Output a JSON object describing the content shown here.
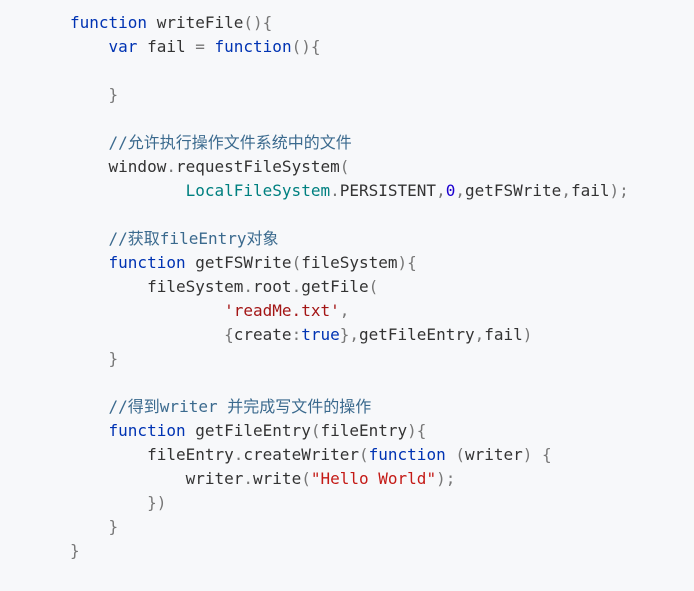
{
  "code": {
    "lines": [
      [
        {
          "t": "function",
          "c": "kw"
        },
        {
          "t": " writeFile",
          "c": ""
        },
        {
          "t": "(){",
          "c": "pu"
        }
      ],
      [
        {
          "t": "    var",
          "c": "kw"
        },
        {
          "t": " fail ",
          "c": ""
        },
        {
          "t": "=",
          "c": "pu"
        },
        {
          "t": " function",
          "c": "kw"
        },
        {
          "t": "(){",
          "c": "pu"
        }
      ],
      [],
      [
        {
          "t": "    }",
          "c": "pu"
        }
      ],
      [],
      [
        {
          "t": "    //允许执行操作文件系统中的文件",
          "c": "cm"
        }
      ],
      [
        {
          "t": "    window",
          "c": ""
        },
        {
          "t": ".",
          "c": "pu"
        },
        {
          "t": "requestFileSystem",
          "c": ""
        },
        {
          "t": "(",
          "c": "pu"
        }
      ],
      [
        {
          "t": "            LocalFileSystem",
          "c": "cl"
        },
        {
          "t": ".",
          "c": "pu"
        },
        {
          "t": "PERSISTENT",
          "c": ""
        },
        {
          "t": ",",
          "c": "pu"
        },
        {
          "t": "0",
          "c": "nu"
        },
        {
          "t": ",",
          "c": "pu"
        },
        {
          "t": "getFSWrite",
          "c": ""
        },
        {
          "t": ",",
          "c": "pu"
        },
        {
          "t": "fail",
          "c": ""
        },
        {
          "t": ");",
          "c": "pu"
        }
      ],
      [],
      [
        {
          "t": "    //获取fileEntry对象",
          "c": "cm"
        }
      ],
      [
        {
          "t": "    function",
          "c": "kw"
        },
        {
          "t": " getFSWrite",
          "c": ""
        },
        {
          "t": "(",
          "c": "pu"
        },
        {
          "t": "fileSystem",
          "c": ""
        },
        {
          "t": "){",
          "c": "pu"
        }
      ],
      [
        {
          "t": "        fileSystem",
          "c": ""
        },
        {
          "t": ".",
          "c": "pu"
        },
        {
          "t": "root",
          "c": ""
        },
        {
          "t": ".",
          "c": "pu"
        },
        {
          "t": "getFile",
          "c": ""
        },
        {
          "t": "(",
          "c": "pu"
        }
      ],
      [
        {
          "t": "                'readMe.txt'",
          "c": "st"
        },
        {
          "t": ",",
          "c": "pu"
        }
      ],
      [
        {
          "t": "                {",
          "c": "pu"
        },
        {
          "t": "create",
          "c": ""
        },
        {
          "t": ":",
          "c": "pu"
        },
        {
          "t": "true",
          "c": "kw"
        },
        {
          "t": "},",
          "c": "pu"
        },
        {
          "t": "getFileEntry",
          "c": ""
        },
        {
          "t": ",",
          "c": "pu"
        },
        {
          "t": "fail",
          "c": ""
        },
        {
          "t": ")",
          "c": "pu"
        }
      ],
      [
        {
          "t": "    }",
          "c": "pu"
        }
      ],
      [],
      [
        {
          "t": "    //得到writer 并完成写文件的操作",
          "c": "cm"
        }
      ],
      [
        {
          "t": "    function",
          "c": "kw"
        },
        {
          "t": " getFileEntry",
          "c": ""
        },
        {
          "t": "(",
          "c": "pu"
        },
        {
          "t": "fileEntry",
          "c": ""
        },
        {
          "t": "){",
          "c": "pu"
        }
      ],
      [
        {
          "t": "        fileEntry",
          "c": ""
        },
        {
          "t": ".",
          "c": "pu"
        },
        {
          "t": "createWriter",
          "c": ""
        },
        {
          "t": "(",
          "c": "pu"
        },
        {
          "t": "function",
          "c": "kw"
        },
        {
          "t": " (",
          "c": "pu"
        },
        {
          "t": "writer",
          "c": ""
        },
        {
          "t": ") {",
          "c": "pu"
        }
      ],
      [
        {
          "t": "            writer",
          "c": ""
        },
        {
          "t": ".",
          "c": "pu"
        },
        {
          "t": "write",
          "c": ""
        },
        {
          "t": "(",
          "c": "pu"
        },
        {
          "t": "\"Hello World\"",
          "c": "st2"
        },
        {
          "t": ");",
          "c": "pu"
        }
      ],
      [
        {
          "t": "        })",
          "c": "pu"
        }
      ],
      [
        {
          "t": "    }",
          "c": "pu"
        }
      ],
      [
        {
          "t": "}",
          "c": "pu"
        }
      ]
    ]
  }
}
